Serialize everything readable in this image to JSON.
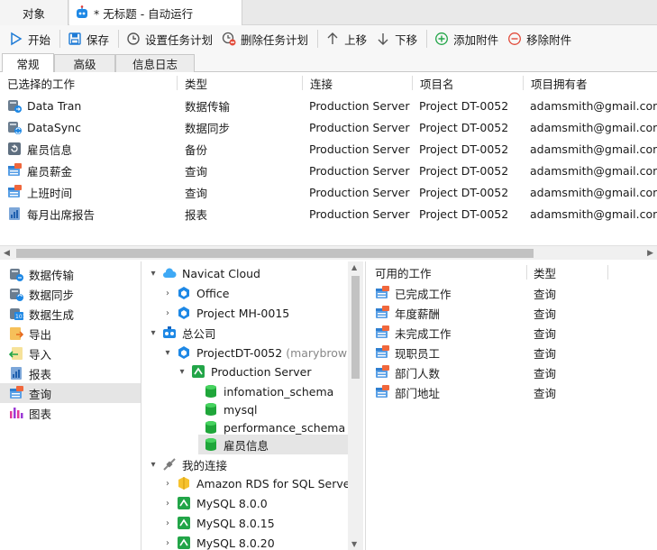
{
  "window_tabs": {
    "objects": "对象",
    "document": "* 无标题 - 自动运行"
  },
  "toolbar": {
    "start": "开始",
    "save": "保存",
    "set_schedule": "设置任务计划",
    "delete_schedule": "删除任务计划",
    "move_up": "上移",
    "move_down": "下移",
    "add_attachment": "添加附件",
    "remove_attachment": "移除附件"
  },
  "subtabs": {
    "general": "常规",
    "advanced": "高级",
    "log": "信息日志"
  },
  "jobs": {
    "headers": {
      "job": "已选择的工作",
      "type": "类型",
      "connection": "连接",
      "project": "项目名",
      "owner": "项目拥有者"
    },
    "rows": [
      {
        "name": "Data Tran",
        "type": "数据传输",
        "connection": "Production Server",
        "project": "Project DT-0052",
        "owner": "adamsmith@gmail.com",
        "icon": "data-transfer-icon"
      },
      {
        "name": "DataSync",
        "type": "数据同步",
        "connection": "Production Server",
        "project": "Project DT-0052",
        "owner": "adamsmith@gmail.com",
        "icon": "data-sync-icon"
      },
      {
        "name": "雇员信息",
        "type": "备份",
        "connection": "Production Server",
        "project": "Project DT-0052",
        "owner": "adamsmith@gmail.com",
        "icon": "backup-icon"
      },
      {
        "name": "雇员薪金",
        "type": "查询",
        "connection": "Production Server",
        "project": "Project DT-0052",
        "owner": "adamsmith@gmail.com",
        "icon": "query-icon"
      },
      {
        "name": "上班时间",
        "type": "查询",
        "connection": "Production Server",
        "project": "Project DT-0052",
        "owner": "adamsmith@gmail.com",
        "icon": "query-icon"
      },
      {
        "name": "每月出席报告",
        "type": "报表",
        "connection": "Production Server",
        "project": "Project DT-0052",
        "owner": "adamsmith@gmail.com",
        "icon": "report-icon"
      }
    ]
  },
  "categories": [
    {
      "label": "数据传输",
      "icon": "data-transfer-icon"
    },
    {
      "label": "数据同步",
      "icon": "data-sync-icon"
    },
    {
      "label": "数据生成",
      "icon": "data-generation-icon"
    },
    {
      "label": "导出",
      "icon": "export-icon"
    },
    {
      "label": "导入",
      "icon": "import-icon"
    },
    {
      "label": "报表",
      "icon": "report-icon"
    },
    {
      "label": "查询",
      "icon": "query-icon",
      "selected": true
    },
    {
      "label": "图表",
      "icon": "chart-icon"
    }
  ],
  "tree": {
    "navicat_cloud": "Navicat Cloud",
    "office": "Office",
    "project_mh": "Project MH-0015",
    "head_office": "总公司",
    "project_dt": "ProjectDT-0052",
    "project_dt_owner": "(marybrown@",
    "production_server": "Production Server",
    "db_info_schema": "infomation_schema",
    "db_mysql": "mysql",
    "db_perf_schema": "performance_schema",
    "db_employee": "雇员信息",
    "my_connections": "我的连接",
    "conn_amazon": "Amazon RDS for SQL Server",
    "conn_mysql800": "MySQL 8.0.0",
    "conn_mysql8015": "MySQL 8.0.15",
    "conn_mysql8020": "MySQL 8.0.20"
  },
  "available": {
    "headers": {
      "job": "可用的工作",
      "type": "类型"
    },
    "rows": [
      {
        "name": "已完成工作",
        "type": "查询"
      },
      {
        "name": "年度薪酬",
        "type": "查询"
      },
      {
        "name": "未完成工作",
        "type": "查询"
      },
      {
        "name": "现职员工",
        "type": "查询"
      },
      {
        "name": "部门人数",
        "type": "查询"
      },
      {
        "name": "部门地址",
        "type": "查询"
      }
    ]
  },
  "colors": {
    "accent_blue": "#1e7bd6",
    "green": "#22a548",
    "red": "#e24b3b"
  }
}
